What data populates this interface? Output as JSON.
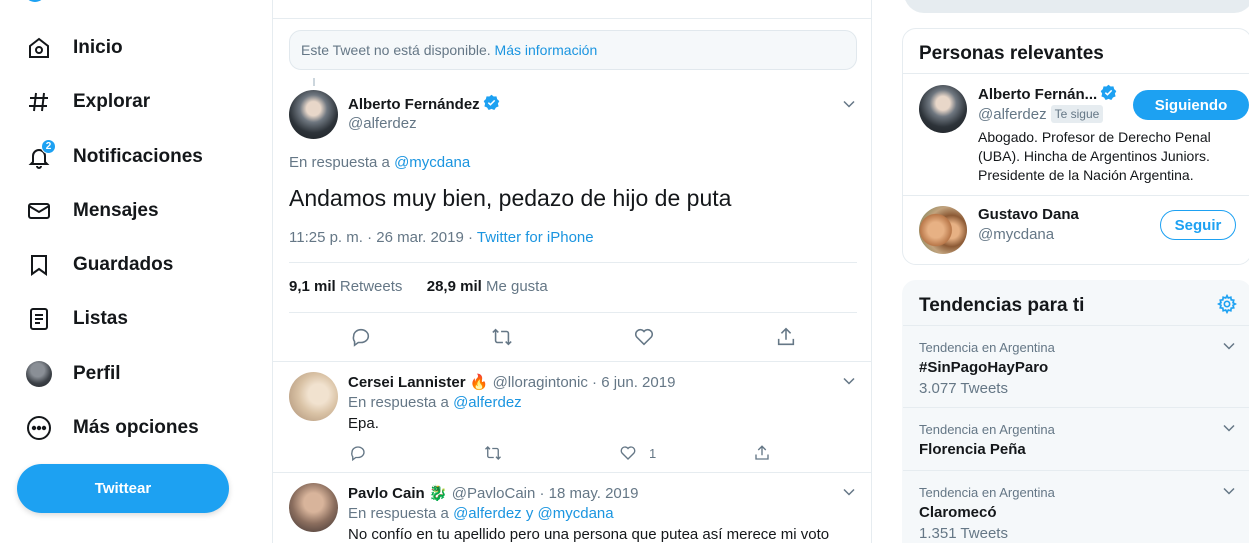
{
  "nav": {
    "items": [
      {
        "label": "Inicio",
        "icon": "home-icon"
      },
      {
        "label": "Explorar",
        "icon": "hashtag-icon"
      },
      {
        "label": "Notificaciones",
        "icon": "bell-icon",
        "badge": "2"
      },
      {
        "label": "Mensajes",
        "icon": "envelope-icon"
      },
      {
        "label": "Guardados",
        "icon": "bookmark-icon"
      },
      {
        "label": "Listas",
        "icon": "list-icon"
      },
      {
        "label": "Perfil",
        "icon": "avatar"
      },
      {
        "label": "Más opciones",
        "icon": "more-circle-icon"
      }
    ],
    "tweet_button": "Twittear"
  },
  "main": {
    "unavailable": {
      "text": "Este Tweet no está disponible.",
      "link": "Más información"
    },
    "tweet": {
      "author": "Alberto Fernández",
      "handle": "@alferdez",
      "reply_prefix": "En respuesta a",
      "reply_to": "@mycdana",
      "text": "Andamos muy bien, pedazo de hijo de puta",
      "time_date": "11:25 p. m. · 26 mar. 2019 ·",
      "source": "Twitter for iPhone",
      "retweets_count": "9,1 mil",
      "retweets_label": "Retweets",
      "likes_count": "28,9 mil",
      "likes_label": "Me gusta"
    },
    "replies": [
      {
        "author": "Cersei Lannister",
        "emoji": "🔥",
        "handle": "@lloragintonic",
        "date": "· 6 jun. 2019",
        "reply_prefix": "En respuesta a",
        "reply_to": "@alferdez",
        "text": "Epa.",
        "likes": "1"
      },
      {
        "author": "Pavlo Cain",
        "emoji": "🐉",
        "handle": "@PavloCain",
        "date": "· 18 may. 2019",
        "reply_prefix": "En respuesta a",
        "reply_to": "@alferdez y @mycdana",
        "text": "No confío en tu apellido pero una persona que putea así merece mi voto"
      }
    ]
  },
  "right": {
    "relevant": {
      "title": "Personas relevantes",
      "people": [
        {
          "name": "Alberto Fernán...",
          "handle": "@alferdez",
          "tag": "Te sigue",
          "button": "Siguiendo",
          "bio": "Abogado. Profesor de Derecho Penal (UBA). Hincha de Argentinos Juniors. Presidente de la Nación Argentina."
        },
        {
          "name": "Gustavo Dana",
          "handle": "@mycdana",
          "button": "Seguir"
        }
      ]
    },
    "trends": {
      "title": "Tendencias para ti",
      "items": [
        {
          "meta": "Tendencia en Argentina",
          "name": "#SinPagoHayParo",
          "count": "3.077 Tweets"
        },
        {
          "meta": "Tendencia en Argentina",
          "name": "Florencia Peña",
          "count": ""
        },
        {
          "meta": "Tendencia en Argentina",
          "name": "Claromecó",
          "count": "1.351 Tweets"
        }
      ]
    }
  },
  "colors": {
    "accent": "#1da1f2",
    "text": "#14171a",
    "muted": "#657786",
    "border": "#e6ecf0"
  }
}
